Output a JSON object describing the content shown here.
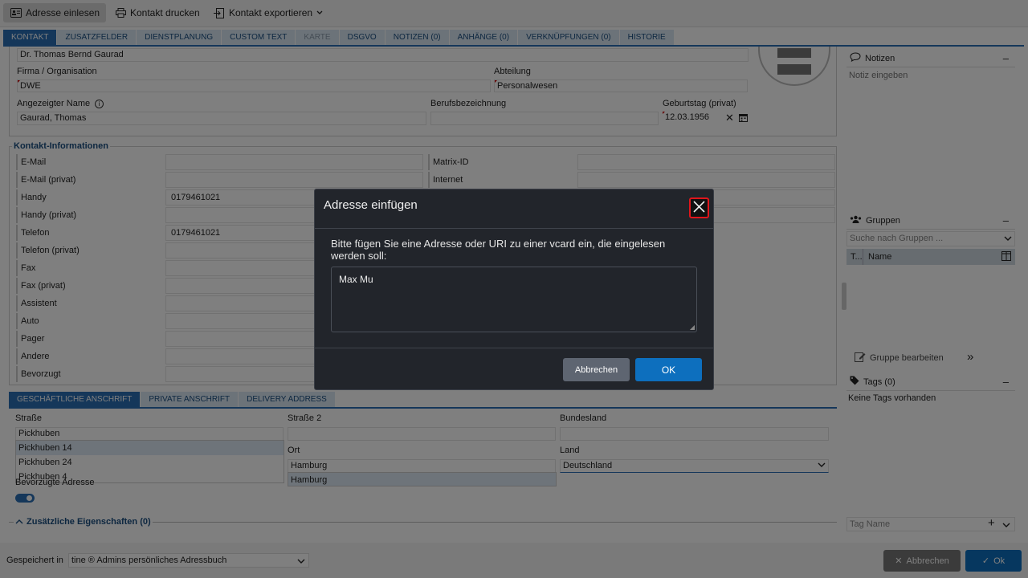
{
  "toolbar": {
    "read_address": "Adresse einlesen",
    "print_contact": "Kontakt drucken",
    "export_contact": "Kontakt exportieren"
  },
  "tabs": [
    "KONTAKT",
    "ZUSATZFELDER",
    "DIENSTPLANUNG",
    "CUSTOM TEXT",
    "KARTE",
    "DSGVO",
    "NOTIZEN (0)",
    "ANHÄNGE (0)",
    "VERKNÜPFUNGEN (0)",
    "HISTORIE"
  ],
  "contact": {
    "full_name": "Dr. Thomas Bernd Gaurad",
    "company_label": "Firma / Organisation",
    "company": "DWE",
    "department_label": "Abteilung",
    "department": "Personalwesen",
    "display_name_label": "Angezeigter Name",
    "display_name": "Gaurad, Thomas",
    "job_title_label": "Berufsbezeichnung",
    "job_title": "",
    "birthday_label": "Geburtstag (privat)",
    "birthday": "12.03.1956"
  },
  "contact_info": {
    "title": "Kontakt-Informationen",
    "left_rows": [
      {
        "label": "E-Mail",
        "value": ""
      },
      {
        "label": "E-Mail (privat)",
        "value": ""
      },
      {
        "label": "Handy",
        "value": "0179461021"
      },
      {
        "label": "Handy (privat)",
        "value": ""
      },
      {
        "label": "Telefon",
        "value": "0179461021"
      },
      {
        "label": "Telefon (privat)",
        "value": ""
      },
      {
        "label": "Fax",
        "value": ""
      },
      {
        "label": "Fax (privat)",
        "value": ""
      },
      {
        "label": "Assistent",
        "value": ""
      },
      {
        "label": "Auto",
        "value": ""
      },
      {
        "label": "Pager",
        "value": ""
      },
      {
        "label": "Andere",
        "value": ""
      },
      {
        "label": "Bevorzugt",
        "value": ""
      }
    ],
    "right_rows": [
      {
        "label": "Matrix-ID",
        "value": ""
      },
      {
        "label": "Internet",
        "value": ""
      }
    ]
  },
  "address_tabs": [
    "GESCHÄFTLICHE ANSCHRIFT",
    "PRIVATE ANSCHRIFT",
    "DELIVERY ADDRESS"
  ],
  "address": {
    "street_label": "Straße",
    "street": "Pickhuben",
    "street_suggestions": [
      "Pickhuben 14",
      "Pickhuben 24",
      "Pickhuben 4"
    ],
    "street2_label": "Straße 2",
    "street2": "",
    "state_label": "Bundesland",
    "state": "",
    "city_label": "Ort",
    "city": "Hamburg",
    "city_suggestion": "Hamburg",
    "country_label": "Land",
    "country": "Deutschland",
    "preferred_label": "Bevorzugte Adresse",
    "extra_props": "Zusätzliche Eigenschaften (0)"
  },
  "sidebar": {
    "notes_title": "Notizen",
    "notes_placeholder": "Notiz eingeben",
    "groups_title": "Gruppen",
    "groups_search": "Suche nach Gruppen ...",
    "col_t": "T...",
    "col_name": "Name",
    "edit_groups": "Gruppe bearbeiten",
    "tags_title": "Tags (0)",
    "no_tags": "Keine Tags vorhanden",
    "tag_name_placeholder": "Tag Name"
  },
  "footer": {
    "saved_in_label": "Gespeichert in",
    "saved_in_value": "tine ® Admins persönliches Adressbuch",
    "cancel": "Abbrechen",
    "ok": "Ok"
  },
  "dialog": {
    "title": "Adresse einfügen",
    "prompt": "Bitte fügen Sie eine Adresse oder URI zu einer vcard ein, die eingelesen werden soll:",
    "input_value": "Max Mu",
    "cancel": "Abbrechen",
    "ok": "OK"
  },
  "colors": {
    "accent": "#2a6fb5",
    "dialog_bg": "#22252b",
    "ok_button": "#0d6fbe",
    "close_highlight": "#e0151b"
  }
}
